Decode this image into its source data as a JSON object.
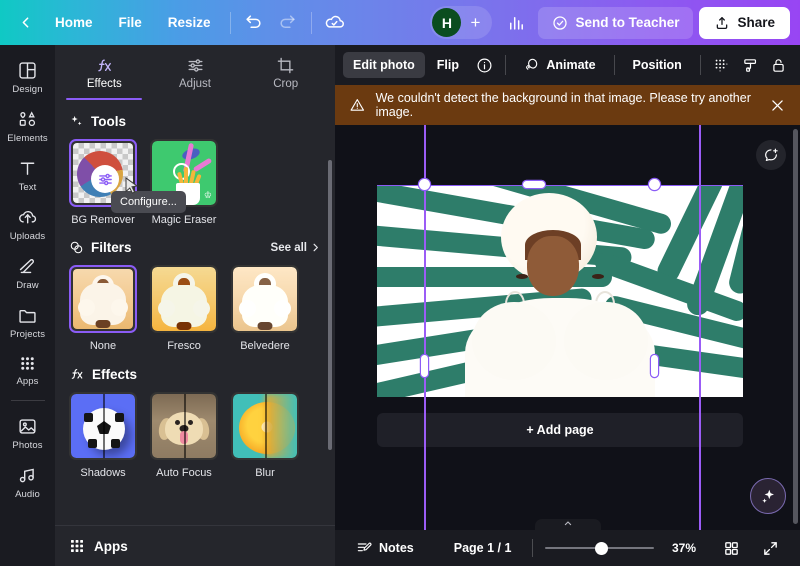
{
  "topbar": {
    "back_label": "",
    "home": "Home",
    "file": "File",
    "resize": "Resize",
    "undo_icon": "undo-icon",
    "redo_icon": "redo-icon",
    "cloud_icon": "cloud-saved-icon",
    "avatar_initial": "H",
    "add_collaborator": "+",
    "insights_icon": "insights-chart-icon",
    "send_to_teacher": "Send to Teacher",
    "share": "Share",
    "gradient_start": "#0fc9c4",
    "gradient_end": "#9845f3"
  },
  "rail": {
    "items": [
      {
        "label": "Design",
        "icon": "design-icon"
      },
      {
        "label": "Elements",
        "icon": "elements-icon"
      },
      {
        "label": "Text",
        "icon": "text-icon"
      },
      {
        "label": "Uploads",
        "icon": "uploads-icon"
      },
      {
        "label": "Draw",
        "icon": "draw-icon"
      },
      {
        "label": "Projects",
        "icon": "projects-folder-icon"
      },
      {
        "label": "Apps",
        "icon": "apps-grid-icon"
      },
      {
        "label": "Photos",
        "icon": "photos-icon"
      },
      {
        "label": "Audio",
        "icon": "audio-icon"
      }
    ]
  },
  "panel": {
    "tabs": [
      {
        "label": "Effects",
        "icon": "fx-icon",
        "active": true
      },
      {
        "label": "Adjust",
        "icon": "sliders-icon",
        "active": false
      },
      {
        "label": "Crop",
        "icon": "crop-icon",
        "active": false
      }
    ],
    "tools": {
      "title": "Tools",
      "icon": "sparkle-icon",
      "items": [
        {
          "label": "BG Remover",
          "selected": true
        },
        {
          "label": "Magic Eraser",
          "selected": false
        }
      ],
      "tooltip": "Configure..."
    },
    "filters": {
      "title": "Filters",
      "icon": "filter-contrast-icon",
      "see_all": "See all",
      "items": [
        {
          "label": "None",
          "selected": true
        },
        {
          "label": "Fresco",
          "selected": false
        },
        {
          "label": "Belvedere",
          "selected": false
        }
      ]
    },
    "effects": {
      "title": "Effects",
      "icon": "fx-icon",
      "items": [
        {
          "label": "Shadows"
        },
        {
          "label": "Auto Focus"
        },
        {
          "label": "Blur"
        }
      ]
    },
    "apps_row": {
      "label": "Apps",
      "icon": "apps-grid-icon"
    },
    "accent": "#8b5cf6"
  },
  "object_toolbar": {
    "edit_photo": "Edit photo",
    "flip": "Flip",
    "info_icon": "info-icon",
    "animate": "Animate",
    "animate_icon": "animate-icon",
    "position": "Position",
    "transparency_icon": "transparency-icon",
    "copy_style_icon": "copy-style-icon",
    "lock_icon": "lock-icon"
  },
  "alert": {
    "icon": "warning-triangle-icon",
    "message": "We couldn't detect the background in that image. Please try another image.",
    "close_icon": "close-icon",
    "bg": "#6b3a10"
  },
  "context_menu": {
    "duplicate_icon": "duplicate-icon",
    "delete_icon": "trash-icon",
    "more_icon": "more-options-icon"
  },
  "canvas": {
    "add_page": "+ Add page",
    "comment_icon": "add-comment-icon",
    "magic_icon": "magic-studio-icon",
    "rotate_icon": "rotate-handle-icon",
    "guide_color": "#9b5cf6",
    "selection_color": "#8b5cf6"
  },
  "bottombar": {
    "notes": "Notes",
    "notes_icon": "notes-icon",
    "page_indicator": "Page 1 / 1",
    "zoom": "37%",
    "grid_view_icon": "grid-view-icon",
    "fullscreen_icon": "fullscreen-icon",
    "collapse_icon": "chevron-up-icon"
  }
}
